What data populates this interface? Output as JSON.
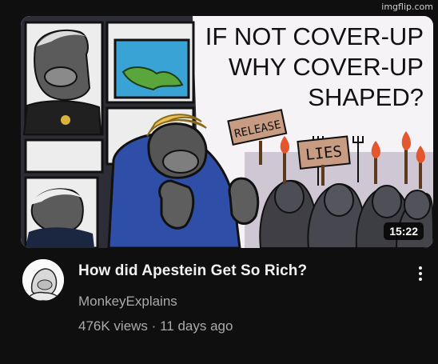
{
  "watermark": "imgflip.com",
  "thumbnail": {
    "headline_lines": [
      "IF NOT COVER-UP",
      "WHY COVER-UP",
      "SHAPED?"
    ],
    "sign_left": "RELEASE",
    "sign_right": "LIES",
    "duration": "15:22"
  },
  "video": {
    "title": "How did Apestein Get So Rich?",
    "channel": "MonkeyExplains",
    "views": "476K views",
    "separator": "·",
    "age": "11 days ago"
  },
  "icons": {
    "more": "more-vert-icon",
    "avatar": "channel-avatar"
  }
}
